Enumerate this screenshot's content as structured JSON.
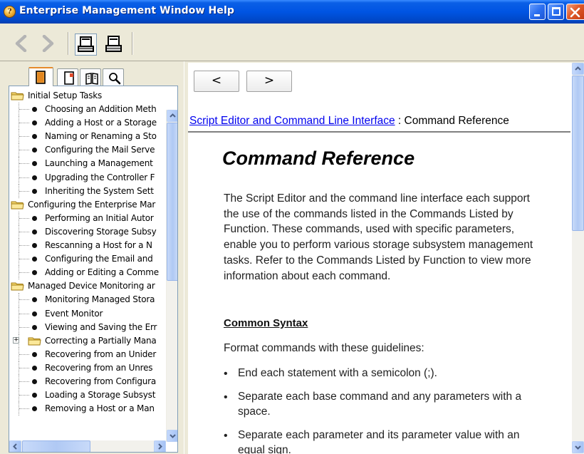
{
  "window": {
    "title": "Enterprise Management Window Help"
  },
  "toolbar": {
    "back_icon": "back-arrow-icon",
    "forward_icon": "forward-arrow-icon",
    "hide_icon": "hide-navigation-icon",
    "print_icon": "print-icon"
  },
  "tabs": [
    {
      "name": "contents",
      "icon": "book-icon"
    },
    {
      "name": "index",
      "icon": "index-icon"
    },
    {
      "name": "glossary",
      "icon": "glossary-icon"
    },
    {
      "name": "search",
      "icon": "search-icon"
    }
  ],
  "tree": {
    "rows": [
      {
        "type": "book",
        "label": "Initial Setup Tasks"
      },
      {
        "type": "page",
        "label": "Choosing an Addition Meth"
      },
      {
        "type": "page",
        "label": "Adding a Host or a Storage"
      },
      {
        "type": "page",
        "label": "Naming or Renaming a Sto"
      },
      {
        "type": "page",
        "label": "Configuring the Mail Serve"
      },
      {
        "type": "page",
        "label": "Launching a Management"
      },
      {
        "type": "page",
        "label": "Upgrading the Controller F"
      },
      {
        "type": "page",
        "label": "Inheriting the System Sett"
      },
      {
        "type": "book",
        "label": "Configuring the Enterprise Mar"
      },
      {
        "type": "page",
        "label": "Performing an Initial Autor"
      },
      {
        "type": "page",
        "label": "Discovering Storage Subsy"
      },
      {
        "type": "page",
        "label": "Rescanning a Host for a N"
      },
      {
        "type": "page",
        "label": "Configuring the Email and"
      },
      {
        "type": "page",
        "label": "Adding or Editing a Comme"
      },
      {
        "type": "book",
        "label": "Managed Device Monitoring ar"
      },
      {
        "type": "page",
        "label": "Monitoring Managed Stora"
      },
      {
        "type": "page",
        "label": "Event Monitor"
      },
      {
        "type": "page",
        "label": "Viewing and Saving the Err"
      },
      {
        "type": "subbook",
        "label": "Correcting a Partially Mana"
      },
      {
        "type": "page",
        "label": "Recovering from an Unider"
      },
      {
        "type": "page",
        "label": "Recovering from an Unres"
      },
      {
        "type": "page",
        "label": "Recovering from Configura"
      },
      {
        "type": "page",
        "label": "Loading a Storage Subsyst"
      },
      {
        "type": "page",
        "label": "Removing a Host or a Man"
      }
    ]
  },
  "content": {
    "nav_prev": "<",
    "nav_next": ">",
    "breadcrumb_link": "Script Editor and Command Line Interface",
    "breadcrumb_sep": " : ",
    "breadcrumb_current": "Command Reference",
    "heading": "Command Reference",
    "intro": "The Script Editor and the command line interface each support the use of the commands listed in the Commands Listed by Function. These commands, used with specific parameters, enable you to perform various storage subsystem management tasks. Refer to the Commands Listed by Function to view more information about each command.",
    "syntax_heading": "Common Syntax",
    "syntax_intro": "Format commands with these guidelines:",
    "guidelines": [
      "End each statement with a semicolon (;).",
      "Separate each base command and any parameters with a space.",
      "Separate each parameter and its parameter value with an equal sign."
    ]
  },
  "colors": {
    "titlebar": "#0054e3",
    "link": "#0000ee",
    "close_button": "#e05a2a"
  }
}
